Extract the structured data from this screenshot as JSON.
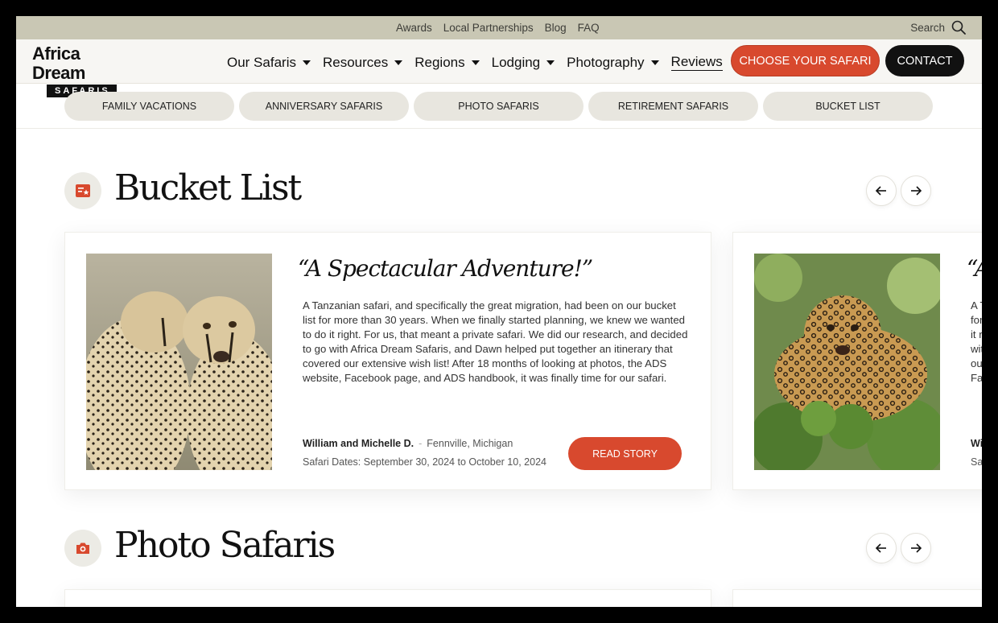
{
  "utility": {
    "links": [
      "Awards",
      "Local Partnerships",
      "Blog",
      "FAQ"
    ],
    "search_label": "Search"
  },
  "header": {
    "logo_line1": "Africa Dream",
    "logo_line2": "SAFARIS",
    "nav": [
      "Our Safaris",
      "Resources",
      "Regions",
      "Lodging",
      "Photography",
      "Reviews"
    ],
    "choose_label": "CHOOSE YOUR SAFARI",
    "contact_label": "CONTACT"
  },
  "pills": [
    "FAMILY VACATIONS",
    "ANNIVERSARY SAFARIS",
    "PHOTO SAFARIS",
    "RETIREMENT SAFARIS",
    "BUCKET LIST"
  ],
  "sections": {
    "bucket": {
      "title": "Bucket List"
    },
    "photo": {
      "title": "Photo Safaris"
    }
  },
  "review": {
    "quote": "“A Spectacular Adventure!”",
    "body": "A Tanzanian safari, and specifically the great migration, had been on our bucket list for more than 30 years. When we finally started planning, we knew we wanted to do it right. For us, that meant a private safari. We did our research, and decided to go with Africa Dream Safaris, and Dawn helped put together an itinerary that covered our extensive wish list! After 18 months of looking at photos, the ADS website, Facebook page, and ADS handbook, it was finally time for our safari.",
    "author": "William and Michelle D.",
    "separator": "-",
    "location": "Fennville, Michigan",
    "dates": "Safari Dates: September 30, 2024 to October 10, 2024",
    "read_label": "READ STORY"
  },
  "peek_review": {
    "quote": "“A",
    "body_lines": [
      "A T",
      "for",
      "it r",
      "wit",
      "ou",
      "Fac"
    ],
    "author": "Wi",
    "dates": "Sa"
  },
  "colors": {
    "accent": "#d8492e",
    "utility_bar": "#c9c7b4",
    "pill": "#e8e6df"
  }
}
